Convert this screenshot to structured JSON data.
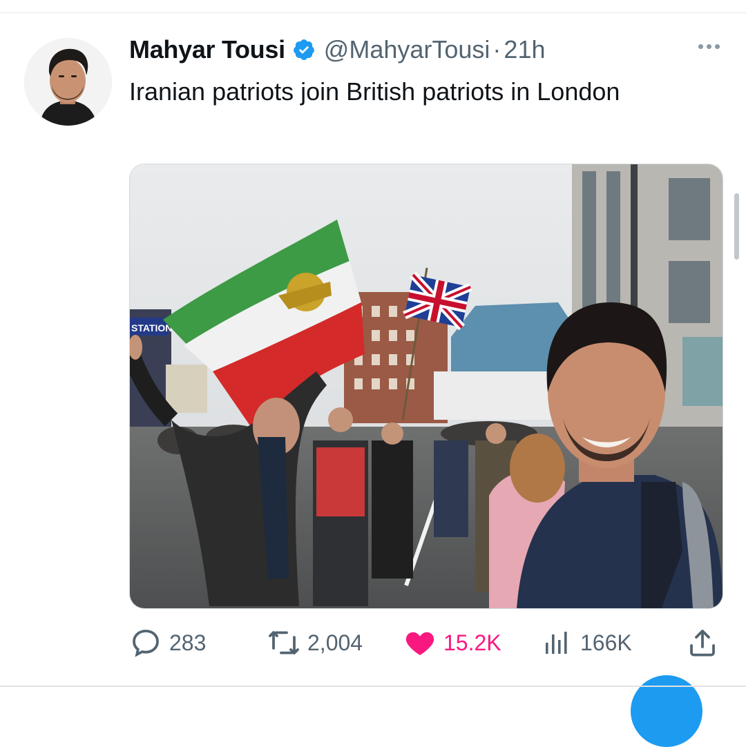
{
  "tweet": {
    "author_name": "Mahyar Tousi",
    "handle": "@MahyarTousi",
    "separator": "·",
    "time": "21h",
    "text": "Iranian patriots join British patriots in London",
    "verified_icon": "verified-badge-icon",
    "more_icon": "more-options-icon"
  },
  "media": {
    "station_sign": "STATION",
    "description_icon": "photo"
  },
  "actions": {
    "replies": "283",
    "reposts": "2,004",
    "likes": "15.2K",
    "views": "166K",
    "reply_icon": "reply-icon",
    "repost_icon": "repost-icon",
    "like_icon": "heart-icon",
    "views_icon": "views-icon",
    "share_icon": "share-icon"
  },
  "colors": {
    "accent": "#1d9bf0",
    "like": "#f91880",
    "secondary_text": "#536471"
  }
}
